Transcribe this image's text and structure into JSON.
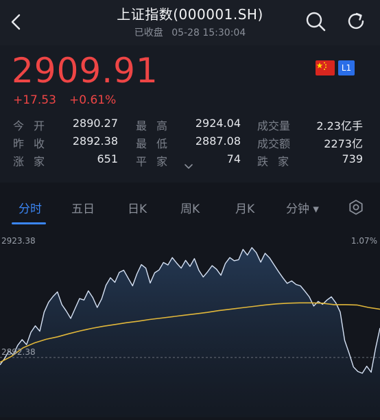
{
  "header": {
    "title": "上证指数(000001.SH)",
    "status": "已收盘",
    "datetime": "05-28 15:30:04"
  },
  "quote": {
    "price": "2909.91",
    "change": "+17.53",
    "change_pct": "+0.61%",
    "badge_level": "L1",
    "colors": {
      "up": "#ee4545",
      "accent": "#3b86f5",
      "avg_line": "#e1b73a",
      "price_line": "#d6e2f5"
    }
  },
  "stats": [
    {
      "label": "今开",
      "value": "2890.27"
    },
    {
      "label": "最高",
      "value": "2924.04"
    },
    {
      "label": "成交量",
      "value": "2.23亿手"
    },
    {
      "label": "昨收",
      "value": "2892.38"
    },
    {
      "label": "最低",
      "value": "2887.08"
    },
    {
      "label": "成交额",
      "value": "2273亿"
    },
    {
      "label": "涨家",
      "value": "651"
    },
    {
      "label": "平家",
      "value": "74"
    },
    {
      "label": "跌家",
      "value": "739"
    }
  ],
  "tabs": [
    {
      "label": "分时",
      "active": true
    },
    {
      "label": "五日"
    },
    {
      "label": "日K"
    },
    {
      "label": "周K"
    },
    {
      "label": "月K"
    },
    {
      "label": "分钟 ▾"
    }
  ],
  "chart_data": {
    "type": "line",
    "y_top_label": "2923.38",
    "y_top_pct": "1.07%",
    "prev_close_label": "2892.38",
    "ylim": [
      2887.5,
      2925.5
    ],
    "prev_close": 2892.38,
    "series": [
      {
        "values": [
          2890.3,
          2892.0,
          2894.2,
          2893.1,
          2895.8,
          2897.4,
          2896.0,
          2899.5,
          2901.3,
          2899.8,
          2905.2,
          2908.0,
          2909.6,
          2910.9,
          2907.3,
          2905.5,
          2903.4,
          2906.2,
          2909.0,
          2908.6,
          2911.2,
          2909.3,
          2906.5,
          2908.9,
          2912.8,
          2914.9,
          2913.6,
          2916.4,
          2917.0,
          2914.8,
          2912.6,
          2916.0,
          2918.6,
          2917.6,
          2913.4,
          2916.3,
          2917.1,
          2919.2,
          2918.5,
          2920.6,
          2919.0,
          2917.6,
          2919.8,
          2918.1,
          2920.3,
          2917.0,
          2915.1,
          2916.6,
          2918.3,
          2917.3,
          2915.6,
          2918.9,
          2920.6,
          2919.7,
          2920.0,
          2922.9,
          2921.3,
          2923.4,
          2922.0,
          2919.3,
          2921.8,
          2920.5,
          2918.6,
          2916.7,
          2914.9,
          2913.3,
          2914.0,
          2913.0,
          2912.6,
          2911.1,
          2909.5,
          2906.9,
          2908.2,
          2907.4,
          2908.6,
          2909.5,
          2907.8,
          2905.2,
          2897.2,
          2893.6,
          2889.7,
          2888.4,
          2887.9,
          2889.9,
          2888.2,
          2895.0,
          2900.7
        ]
      },
      {
        "values": [
          2891.0,
          2892.7,
          2895.1,
          2896.5,
          2897.5,
          2898.2,
          2899.1,
          2899.9,
          2900.6,
          2901.2,
          2901.7,
          2902.2,
          2902.6,
          2903.1,
          2903.5,
          2903.9,
          2904.3,
          2904.7,
          2905.1,
          2905.6,
          2906.0,
          2906.4,
          2906.8,
          2907.2,
          2907.5,
          2907.7,
          2907.8,
          2907.8,
          2907.7,
          2907.3,
          2907.3,
          2907.2,
          2906.5,
          2906.0
        ]
      }
    ]
  }
}
